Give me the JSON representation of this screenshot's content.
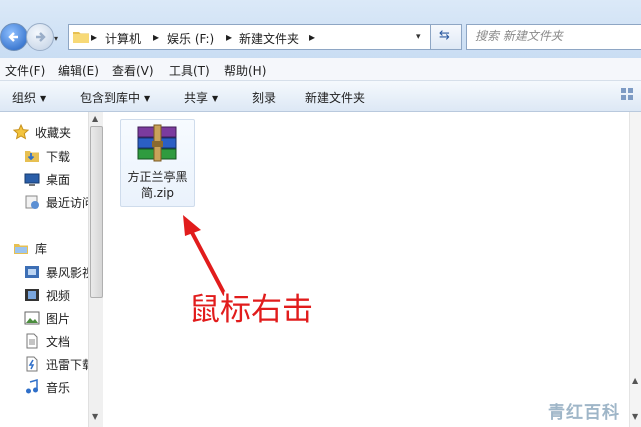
{
  "address": {
    "crumbs": [
      "计算机",
      "娱乐 (F:)",
      "新建文件夹"
    ],
    "separator": "▸",
    "dropdown": "▾"
  },
  "search": {
    "placeholder": "搜索 新建文件夹"
  },
  "menubar": [
    {
      "label": "文件(F)"
    },
    {
      "label": "编辑(E)"
    },
    {
      "label": "查看(V)"
    },
    {
      "label": "工具(T)"
    },
    {
      "label": "帮助(H)"
    }
  ],
  "commandbar": {
    "organize": "组织",
    "include": "包含到库中",
    "share": "共享",
    "burn": "刻录",
    "newfolder": "新建文件夹",
    "arrow": "▼"
  },
  "nav": {
    "favorites": {
      "label": "收藏夹",
      "icon": "star-icon"
    },
    "downloads": {
      "label": "下载",
      "icon": "download-folder-icon"
    },
    "desktop": {
      "label": "桌面",
      "icon": "desktop-icon"
    },
    "recent": {
      "label": "最近访问",
      "icon": "recent-places-icon"
    },
    "libraries": {
      "label": "库",
      "icon": "library-icon"
    },
    "video_lib": {
      "label": "暴风影视",
      "icon": "video-library-icon"
    },
    "videos": {
      "label": "视频",
      "icon": "video-icon"
    },
    "pictures": {
      "label": "图片",
      "icon": "picture-icon"
    },
    "documents": {
      "label": "文档",
      "icon": "document-icon"
    },
    "thunder": {
      "label": "迅雷下载",
      "icon": "thunder-download-icon"
    },
    "music": {
      "label": "音乐",
      "icon": "music-icon"
    }
  },
  "file": {
    "name": "方正兰亭黑简.zip",
    "icon": "winrar-archive-icon"
  },
  "annotation": "鼠标右击",
  "watermark": "青红百科",
  "colors": {
    "annotation": "#e11c1c",
    "accent": "#1f5fbf"
  }
}
